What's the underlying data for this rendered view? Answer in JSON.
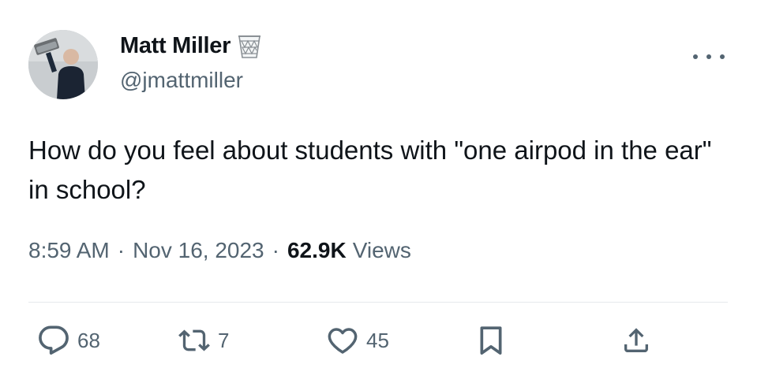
{
  "author": {
    "display_name": "Matt Miller",
    "handle": "@jmattmiller",
    "avatar_icon": "user-photo",
    "affiliation_icon": "wastebasket-icon"
  },
  "tweet": {
    "text": "How do you feel about students with \"one airpod in the ear\" in school?"
  },
  "meta": {
    "time": "8:59 AM",
    "separator": "·",
    "date": "Nov 16, 2023",
    "views_count": "62.9K",
    "views_label": "Views"
  },
  "actions": {
    "replies": "68",
    "retweets": "7",
    "likes": "45"
  },
  "colors": {
    "text": "#0f1419",
    "secondary": "#536471",
    "divider": "#e6e9ec"
  }
}
